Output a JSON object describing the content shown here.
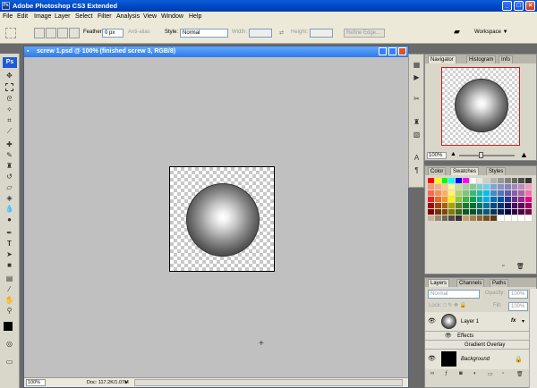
{
  "titlebar": {
    "title": "Adobe Photoshop CS3 Extended",
    "ps": "Ps",
    "min": "_",
    "max": "□",
    "close": "×"
  },
  "menu": [
    "File",
    "Edit",
    "Image",
    "Layer",
    "Select",
    "Filter",
    "Analysis",
    "View",
    "Window",
    "Help"
  ],
  "options": {
    "feather_label": "Feather:",
    "feather_value": "0 px",
    "antialias_label": "Anti-alias",
    "style_label": "Style:",
    "style_value": "Normal",
    "width_label": "Width:",
    "height_label": "Height:",
    "refine_label": "Refine Edge...",
    "workspace_label": "Workspace ▼"
  },
  "toolbox": {
    "ps": "Ps"
  },
  "document": {
    "title": "screw 1.psd @ 100% (finished screw 3, RGB/8)",
    "zoom": "100%",
    "doc_info": "Doc: 117.2K/1.07M"
  },
  "navigator": {
    "tabs": [
      "Navigator",
      "Histogram",
      "Info"
    ],
    "zoom": "100%"
  },
  "swatches": {
    "tabs": [
      "Color",
      "Swatches",
      "Styles"
    ]
  },
  "layers": {
    "tabs": [
      "Layers",
      "Channels",
      "Paths"
    ],
    "blend": "Normal",
    "opacity_label": "Opacity:",
    "opacity": "100%",
    "lock_label": "Lock:",
    "fill_label": "Fill:",
    "fill": "100%",
    "items": [
      {
        "name": "Layer 1",
        "fx": "fx"
      },
      {
        "name": "Effects"
      },
      {
        "name": "Gradient Overlay"
      },
      {
        "name": "Background"
      }
    ]
  },
  "colors": {
    "titlebar": "#0045c2",
    "canvas": "#c0c0c0",
    "chrome": "#ece9d8"
  }
}
